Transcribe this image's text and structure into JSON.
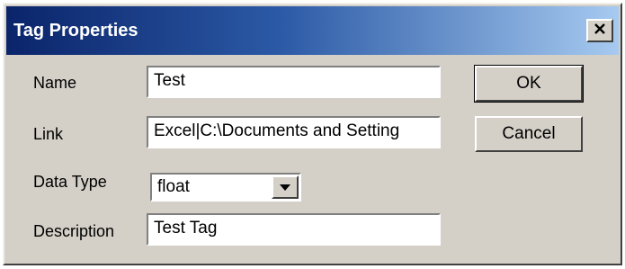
{
  "dialog": {
    "title": "Tag Properties",
    "close_icon": "close-icon"
  },
  "form": {
    "name_label": "Name",
    "name_value": "Test",
    "link_label": "Link",
    "link_value": "Excel|C:\\Documents and Setting",
    "data_type_label": "Data Type",
    "data_type_value": "float",
    "description_label": "Description",
    "description_value": "Test Tag"
  },
  "buttons": {
    "ok_label": "OK",
    "cancel_label": "Cancel"
  },
  "colors": {
    "face": "#d4d0c8",
    "title_start": "#0a246a",
    "title_end": "#a6caf0"
  }
}
